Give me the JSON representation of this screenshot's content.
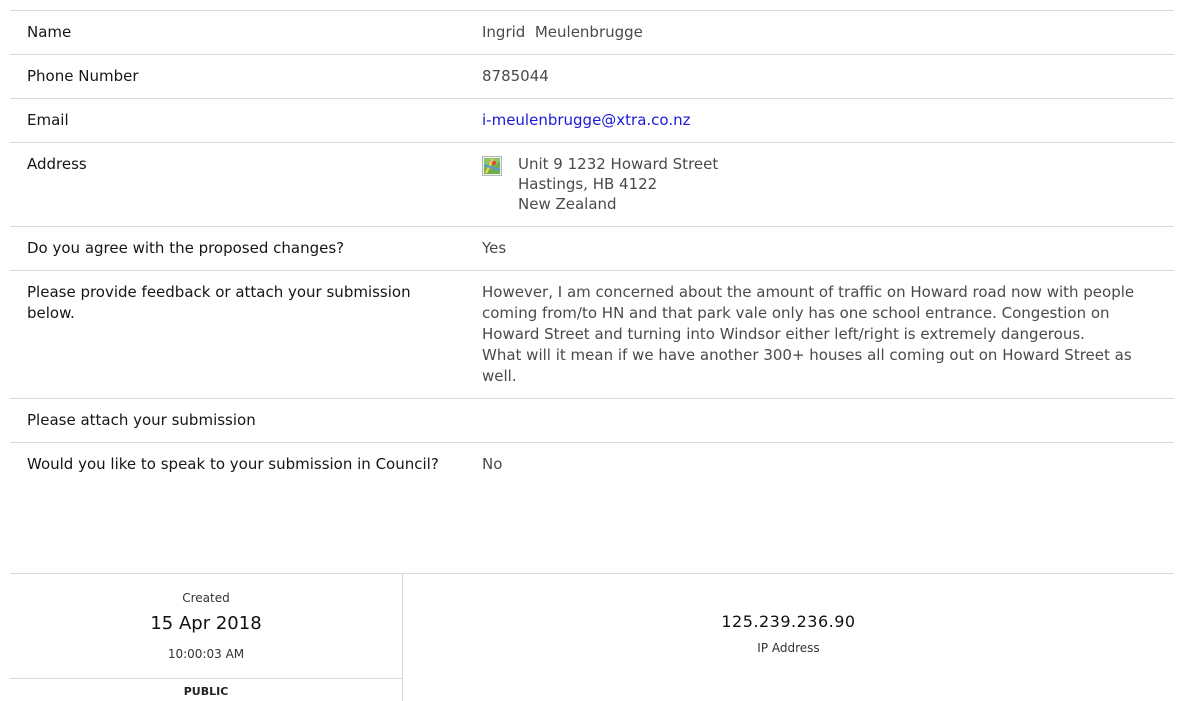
{
  "fields": {
    "name": {
      "label": "Name",
      "value": "Ingrid  Meulenbrugge"
    },
    "phone": {
      "label": "Phone Number",
      "value": "8785044"
    },
    "email": {
      "label": "Email",
      "value": "i-meulenbrugge@xtra.co.nz"
    },
    "address": {
      "label": "Address",
      "icon": "map-icon",
      "line1": "Unit 9 1232 Howard Street",
      "line2": "Hastings, HB 4122",
      "line3": "New Zealand"
    },
    "agree": {
      "label": "Do you agree with the proposed changes?",
      "value": "Yes"
    },
    "feedback": {
      "label": "Please provide feedback or attach your submission below.",
      "paragraph1": "However, I am concerned about the amount of traffic on Howard road now with people coming from/to HN and that park vale only has one school entrance. Congestion on Howard Street and turning into Windsor either left/right is extremely dangerous.",
      "paragraph2": "What will it mean if we have another 300+ houses all coming out on Howard Street as well."
    },
    "attach": {
      "label": "Please attach your submission",
      "value": ""
    },
    "speak": {
      "label": "Would you like to speak to your submission in Council?",
      "value": "No"
    }
  },
  "meta": {
    "created_label": "Created",
    "created_date": "15 Apr 2018",
    "created_time": "10:00:03 AM",
    "visibility": "PUBLIC",
    "ip_address": "125.239.236.90",
    "ip_label": "IP Address"
  },
  "colors": {
    "link": "#1a1ad6",
    "divider": "#d9d9d9"
  }
}
